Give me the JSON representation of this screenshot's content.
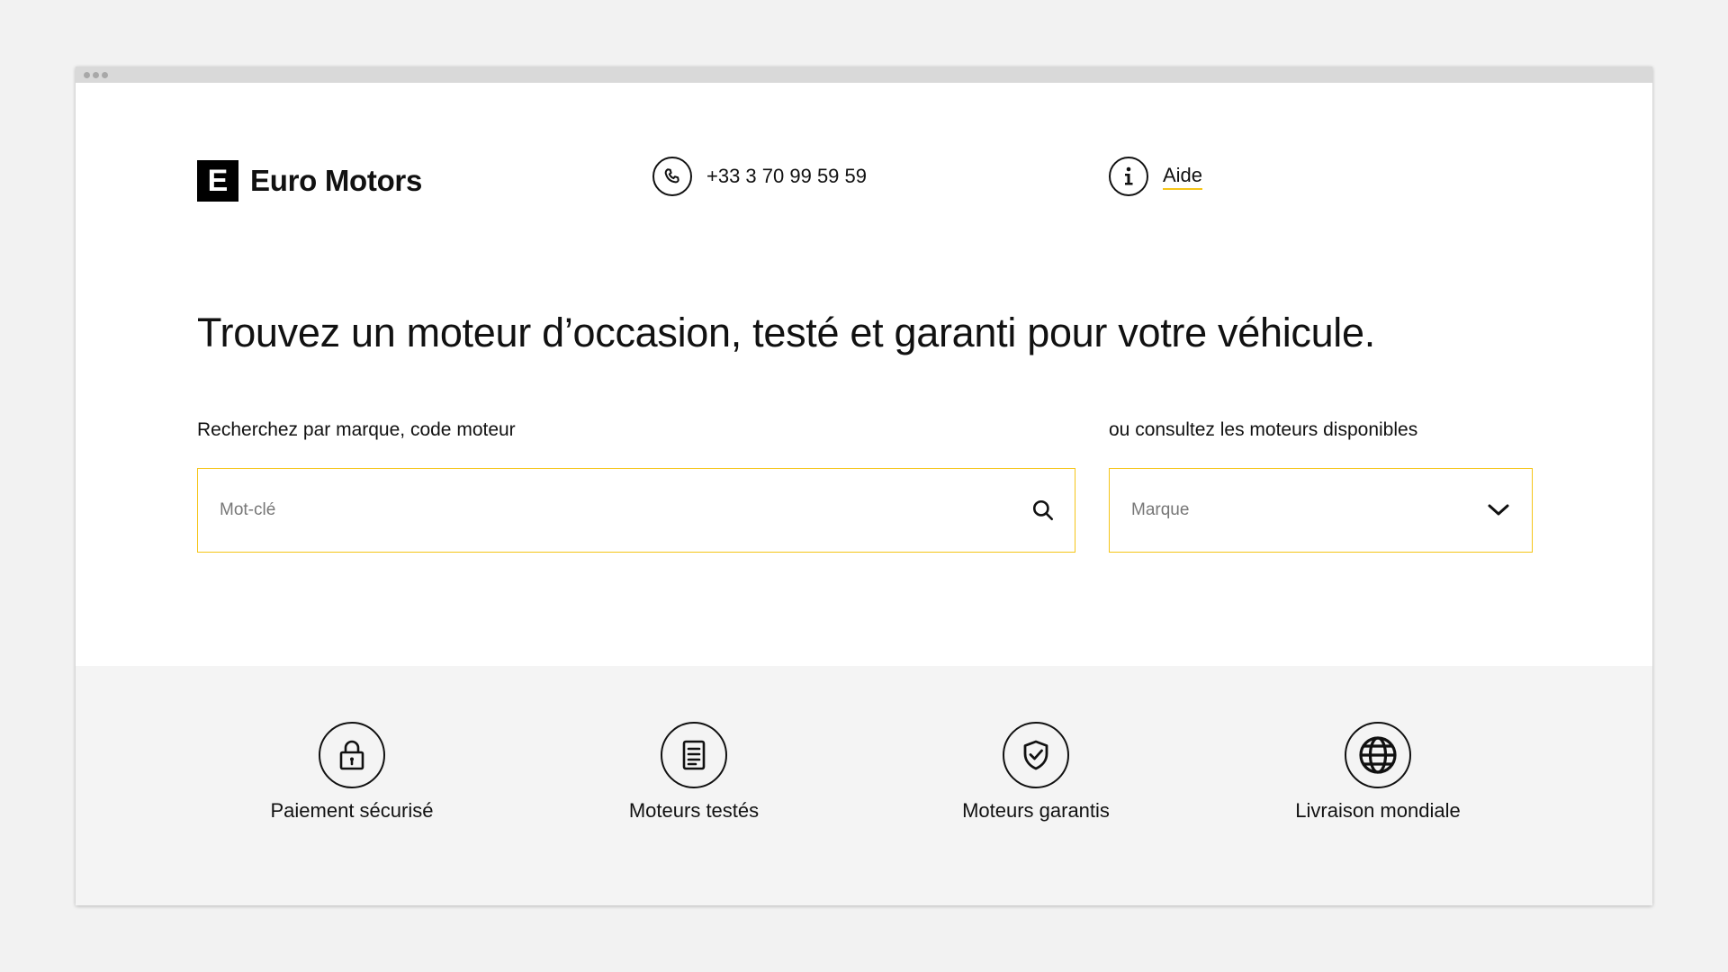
{
  "brand": {
    "logo_letter": "E",
    "name": "Euro Motors",
    "accent_color": "#f5c518"
  },
  "header": {
    "phone": "+33 3 70 99 59 59",
    "help_label": "Aide"
  },
  "hero": {
    "headline": "Trouvez un moteur d’occasion, testé et garanti pour votre véhicule."
  },
  "search": {
    "label": "Recherchez par marque, code moteur",
    "placeholder": "Mot-clé",
    "value": ""
  },
  "browse": {
    "label": "ou consultez les moteurs disponibles",
    "selected": "Marque"
  },
  "features": [
    {
      "label": "Paiement sécurisé",
      "icon": "lock-icon"
    },
    {
      "label": "Moteurs testés",
      "icon": "document-icon"
    },
    {
      "label": "Moteurs garantis",
      "icon": "shield-check-icon"
    },
    {
      "label": "Livraison mondiale",
      "icon": "globe-icon"
    }
  ]
}
